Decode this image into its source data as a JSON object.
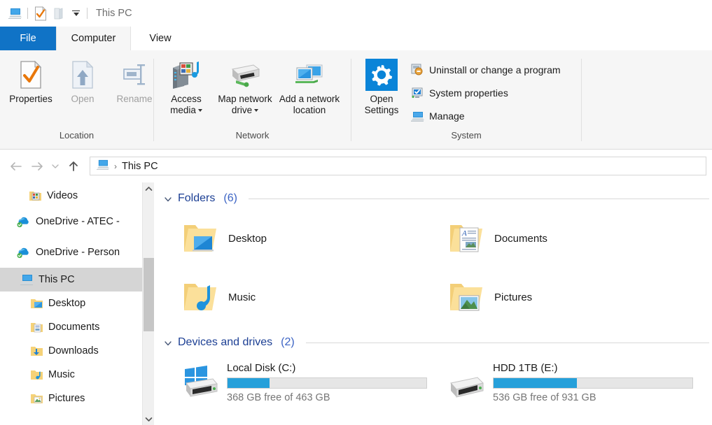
{
  "titlebar": {
    "title": "This PC",
    "qat": [
      {
        "name": "this-pc-icon",
        "label": "This PC"
      },
      {
        "name": "properties-icon",
        "label": "Properties"
      },
      {
        "name": "new-folder-icon",
        "label": "New folder"
      },
      {
        "name": "customize-quick-access-toolbar-icon",
        "label": "Customize Quick Access Toolbar"
      }
    ]
  },
  "tabs": [
    {
      "id": "file",
      "label": "File"
    },
    {
      "id": "computer",
      "label": "Computer"
    },
    {
      "id": "view",
      "label": "View"
    }
  ],
  "ribbon": {
    "groups": [
      {
        "label": "Location",
        "buttons": [
          {
            "name": "properties-button",
            "label": "Properties",
            "icon": "properties-icon",
            "disabled": false
          },
          {
            "name": "open-button",
            "label": "Open",
            "icon": "open-icon",
            "disabled": true
          },
          {
            "name": "rename-button",
            "label": "Rename",
            "icon": "rename-icon",
            "disabled": true
          }
        ]
      },
      {
        "label": "Network",
        "buttons": [
          {
            "name": "access-media-button",
            "label": "Access media",
            "icon": "access-media-icon",
            "dropdown": true
          },
          {
            "name": "map-network-drive-button",
            "label": "Map network drive",
            "icon": "map-network-drive-icon",
            "dropdown": true
          },
          {
            "name": "add-a-network-location-button",
            "label": "Add a network location",
            "icon": "add-network-location-icon",
            "dropdown": false
          }
        ]
      },
      {
        "label": "System",
        "big": {
          "name": "open-settings-button",
          "label": "Open Settings",
          "icon": "settings-gear-icon"
        },
        "small": [
          {
            "name": "uninstall-or-change-a-program-button",
            "label": "Uninstall or change a program",
            "icon": "uninstall-program-icon"
          },
          {
            "name": "system-properties-button",
            "label": "System properties",
            "icon": "system-properties-icon"
          },
          {
            "name": "manage-button",
            "label": "Manage",
            "icon": "manage-icon"
          }
        ]
      }
    ]
  },
  "addressbar": {
    "back": "Back",
    "forward": "Forward",
    "recent": "Recent locations",
    "up": "Up",
    "breadcrumb": "This PC",
    "separator": "›"
  },
  "sidebar": {
    "items": [
      {
        "name": "sidebar-item-videos",
        "label": "Videos",
        "icon": "videos-folder-icon",
        "indent": 1,
        "selected": false
      },
      {
        "name": "sidebar-item-onedrive-atec",
        "label": "OneDrive - ATEC -",
        "icon": "onedrive-icon",
        "indent": 0,
        "selected": false
      },
      {
        "name": "sidebar-item-onedrive-personal",
        "label": "OneDrive - Person",
        "icon": "onedrive-icon",
        "indent": 0,
        "selected": false
      },
      {
        "name": "sidebar-item-this-pc",
        "label": "This PC",
        "icon": "this-pc-icon",
        "indent": 0,
        "selected": true
      },
      {
        "name": "sidebar-item-desktop",
        "label": "Desktop",
        "icon": "desktop-folder-icon",
        "indent": 1,
        "selected": false
      },
      {
        "name": "sidebar-item-documents",
        "label": "Documents",
        "icon": "documents-folder-icon",
        "indent": 1,
        "selected": false
      },
      {
        "name": "sidebar-item-downloads",
        "label": "Downloads",
        "icon": "downloads-folder-icon",
        "indent": 1,
        "selected": false
      },
      {
        "name": "sidebar-item-music",
        "label": "Music",
        "icon": "music-folder-icon",
        "indent": 1,
        "selected": false
      },
      {
        "name": "sidebar-item-pictures",
        "label": "Pictures",
        "icon": "pictures-folder-icon",
        "indent": 1,
        "selected": false
      }
    ],
    "scrollbar": {
      "up": "Scroll up",
      "down": "Scroll down",
      "thumb": "Scroll thumb"
    }
  },
  "main": {
    "sections": [
      {
        "id": "folders",
        "title": "Folders",
        "count": "(6)",
        "items": [
          {
            "name": "folder-desktop",
            "label": "Desktop",
            "icon": "desktop-folder-icon"
          },
          {
            "name": "folder-documents",
            "label": "Documents",
            "icon": "documents-folder-icon"
          },
          {
            "name": "folder-music",
            "label": "Music",
            "icon": "music-folder-icon"
          },
          {
            "name": "folder-pictures",
            "label": "Pictures",
            "icon": "pictures-folder-icon"
          }
        ]
      },
      {
        "id": "devices-and-drives",
        "title": "Devices and drives",
        "count": "(2)",
        "drives": [
          {
            "name": "drive-local-disk-c",
            "label": "Local Disk (C:)",
            "free_text": "368 GB free of 463 GB",
            "used_percent": 21,
            "icon": "windows-drive-icon"
          },
          {
            "name": "drive-hdd-1tb-e",
            "label": "HDD 1TB (E:)",
            "free_text": "536 GB free of 931 GB",
            "used_percent": 42,
            "icon": "hdd-drive-icon"
          }
        ]
      }
    ]
  },
  "colors": {
    "accent_blue": "#1073c6",
    "drive_bar_blue": "#26a0da",
    "section_title_blue": "#1c3f94",
    "selection_grey": "#d5d5d5",
    "folder_yellow": "#f7d77f"
  }
}
